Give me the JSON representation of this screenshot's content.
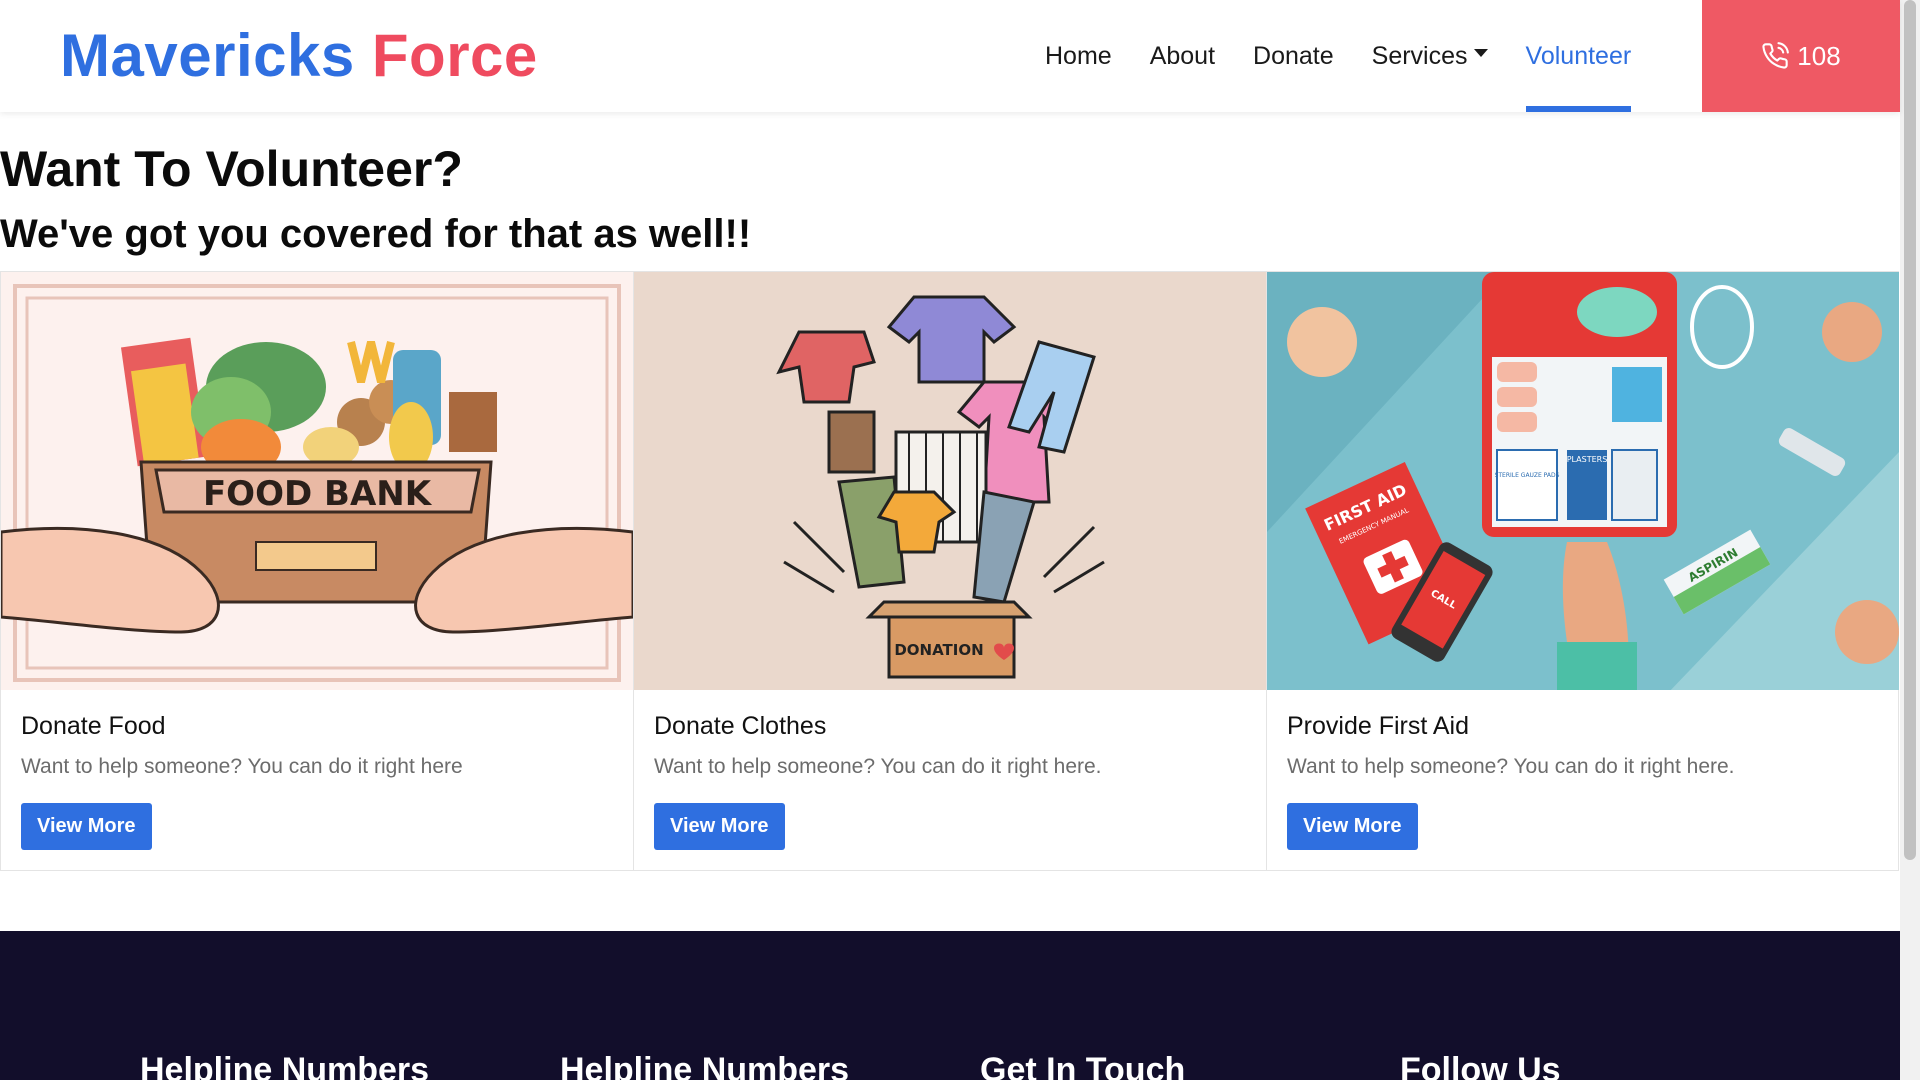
{
  "brand": {
    "part1": "Mavericks",
    "part2": "Force"
  },
  "nav": {
    "items": [
      "Home",
      "About",
      "Donate",
      "Services",
      "Volunteer"
    ],
    "active": "Volunteer",
    "call_label": "108"
  },
  "hero": {
    "title": "Want To Volunteer?",
    "subtitle": "We've got you covered for that as well!!"
  },
  "cards": [
    {
      "title": "Donate Food",
      "text": "Want to help someone? You can do it right here",
      "button": "View More",
      "img_label": "FOOD BANK"
    },
    {
      "title": "Donate Clothes",
      "text": "Want to help someone? You can do it right here.",
      "button": "View More",
      "img_label": "DONATION"
    },
    {
      "title": "Provide First Aid",
      "text": "Want to help someone? You can do it right here.",
      "button": "View More",
      "img_labels": [
        "FIRST AID",
        "EMERGENCY MANUAL",
        "CALL",
        "PLASTERS",
        "STERILE GAUZE PADS",
        "ASPIRIN"
      ]
    }
  ],
  "footer": {
    "columns": [
      "Helpline Numbers",
      "Helpline Numbers",
      "Get In Touch",
      "Follow Us"
    ]
  },
  "colors": {
    "primary": "#2f6fe0",
    "accent": "#ef4b5f",
    "footer_bg": "#120e2b"
  }
}
